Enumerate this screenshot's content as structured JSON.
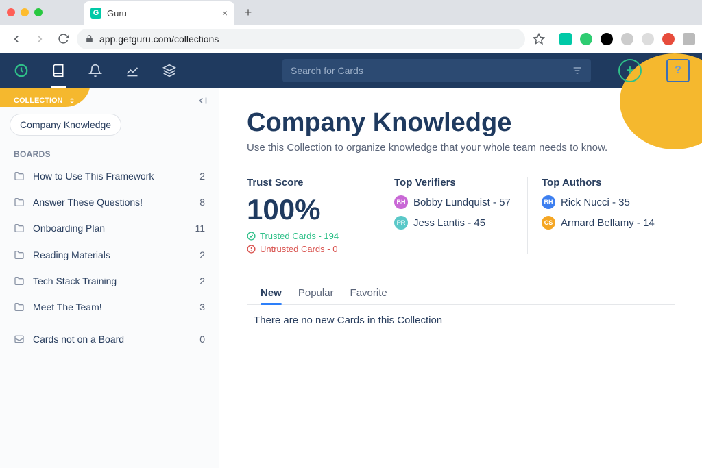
{
  "browser": {
    "tab_title": "Guru",
    "url": "app.getguru.com/collections"
  },
  "header": {
    "search_placeholder": "Search for Cards"
  },
  "sidebar": {
    "collection_label": "COLLECTION",
    "collection_name": "Company Knowledge",
    "boards_label": "BOARDS",
    "boards": [
      {
        "name": "How to Use This Framework",
        "count": "2"
      },
      {
        "name": "Answer These Questions!",
        "count": "8"
      },
      {
        "name": "Onboarding Plan",
        "count": "11"
      },
      {
        "name": "Reading Materials",
        "count": "2"
      },
      {
        "name": "Tech Stack Training",
        "count": "2"
      },
      {
        "name": "Meet The Team!",
        "count": "3"
      }
    ],
    "loose_cards": {
      "name": "Cards not on a Board",
      "count": "0"
    }
  },
  "main": {
    "title": "Company Knowledge",
    "subtitle": "Use this Collection to organize knowledge that your whole team needs to know.",
    "trust": {
      "label": "Trust Score",
      "score": "100%",
      "trusted": "Trusted Cards - 194",
      "untrusted": "Untrusted Cards - 0"
    },
    "verifiers": {
      "label": "Top Verifiers",
      "people": [
        {
          "initials": "BH",
          "color": "#c968d6",
          "text": "Bobby Lundquist - 57"
        },
        {
          "initials": "PR",
          "color": "#5ac8c8",
          "text": "Jess Lantis  - 45"
        }
      ]
    },
    "authors": {
      "label": "Top Authors",
      "people": [
        {
          "initials": "BH",
          "color": "#3d7ff0",
          "text": "Rick Nucci - 35"
        },
        {
          "initials": "CS",
          "color": "#f5a623",
          "text": "Armard Bellamy - 14"
        }
      ]
    },
    "tabs": [
      "New",
      "Popular",
      "Favorite"
    ],
    "active_tab": 0,
    "empty_message": "There are no new Cards in this Collection"
  }
}
